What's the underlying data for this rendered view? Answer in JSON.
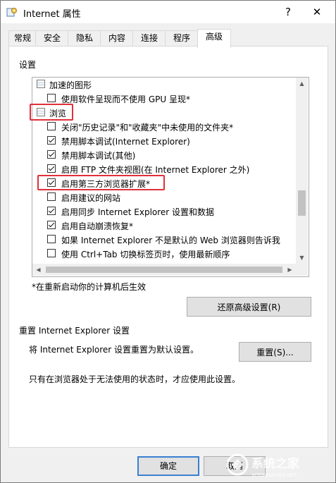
{
  "window": {
    "title": "Internet 属性",
    "help": "?",
    "close": "✕"
  },
  "tabs": [
    {
      "label": "常规"
    },
    {
      "label": "安全"
    },
    {
      "label": "隐私"
    },
    {
      "label": "内容"
    },
    {
      "label": "连接"
    },
    {
      "label": "程序"
    },
    {
      "label": "高级"
    }
  ],
  "settings": {
    "group_label": "设置",
    "items": [
      {
        "kind": "category",
        "label": "加速的图形"
      },
      {
        "kind": "checkbox",
        "checked": false,
        "label": "使用软件呈现而不使用 GPU 呈现*"
      },
      {
        "kind": "category",
        "label": "浏览"
      },
      {
        "kind": "checkbox",
        "checked": false,
        "label": "关闭\"历史记录\"和\"收藏夹\"中未使用的文件夹*"
      },
      {
        "kind": "checkbox",
        "checked": true,
        "label": "禁用脚本调试(Internet Explorer)"
      },
      {
        "kind": "checkbox",
        "checked": true,
        "label": "禁用脚本调试(其他)"
      },
      {
        "kind": "checkbox",
        "checked": true,
        "label": "启用 FTP 文件夹视图(在 Internet Explorer 之外)"
      },
      {
        "kind": "checkbox",
        "checked": true,
        "label": "启用第三方浏览器扩展*"
      },
      {
        "kind": "checkbox",
        "checked": false,
        "label": "启用建议的网站"
      },
      {
        "kind": "checkbox",
        "checked": true,
        "label": "启用同步 Internet Explorer 设置和数据"
      },
      {
        "kind": "checkbox",
        "checked": true,
        "label": "启用自动崩溃恢复*"
      },
      {
        "kind": "checkbox",
        "checked": false,
        "label": "如果 Internet Explorer 不是默认的 Web 浏览器则告诉我"
      },
      {
        "kind": "checkbox",
        "checked": false,
        "label": "使用 Ctrl+Tab 切换标签页时，使用最新顺序"
      }
    ],
    "restart_note": "*在重新启动你的计算机后生效",
    "restore_button": "还原高级设置(R)"
  },
  "reset": {
    "heading": "重置 Internet Explorer 设置",
    "description": "将 Internet Explorer 设置重置为默认设置。",
    "button": "重置(S)...",
    "note": "只有在浏览器处于无法使用的状态时，才应使用此设置。"
  },
  "footer": {
    "ok": "确定",
    "cancel": "取消"
  },
  "watermark": {
    "text": "系统之家",
    "url": "XITONGZHIJIA.NET"
  }
}
